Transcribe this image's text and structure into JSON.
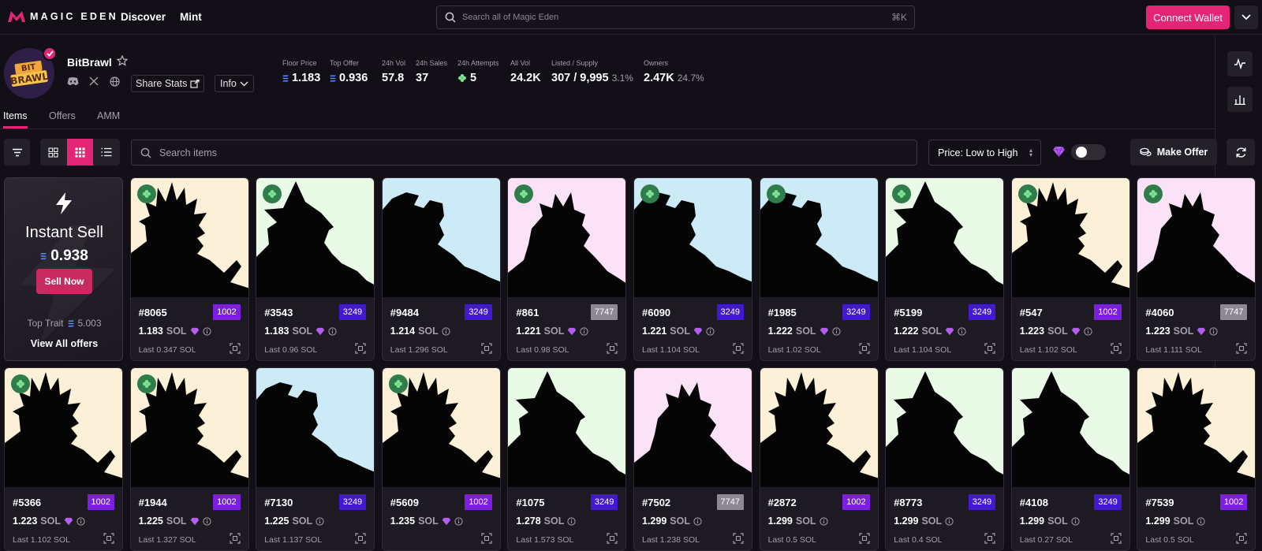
{
  "topbar": {
    "logo_text": "MAGIC EDEN",
    "nav": [
      "Discover",
      "Mint"
    ],
    "search_placeholder": "Search all of Magic Eden",
    "search_shortcut": "⌘K",
    "connect_label": "Connect Wallet"
  },
  "collection": {
    "name": "BitBrawl",
    "avatar_text": "BIT BRAWL",
    "share_label": "Share Stats",
    "info_label": "Info",
    "stats": [
      {
        "label": "Floor Price",
        "value": "1.183",
        "sol": true,
        "sub": ""
      },
      {
        "label": "Top Offer",
        "value": "0.936",
        "sol": true,
        "sub": ""
      },
      {
        "label": "24h Vol",
        "value": "57.8",
        "sol": false,
        "sub": ""
      },
      {
        "label": "24h Sales",
        "value": "37",
        "sol": false,
        "sub": ""
      },
      {
        "label": "24h Attempts",
        "value": "5",
        "sol": false,
        "clover": true,
        "sub": ""
      },
      {
        "label": "All Vol",
        "value": "24.2K",
        "sol": false,
        "sub": ""
      },
      {
        "label": "Listed / Supply",
        "value": "307 / 9,995",
        "sol": false,
        "sub": "3.1%"
      },
      {
        "label": "Owners",
        "value": "2.47K",
        "sol": false,
        "sub": "24.7%"
      }
    ]
  },
  "tabs": [
    "Items",
    "Offers",
    "AMM"
  ],
  "toolbar": {
    "search_placeholder": "Search items",
    "sort_label": "Price: Low to High",
    "make_offer_label": "Make Offer"
  },
  "instant_sell": {
    "title": "Instant Sell",
    "price": "0.938",
    "sell_label": "Sell Now",
    "trait_label": "Top Trait",
    "trait_value": "5.003",
    "view_all_label": "View All offers"
  },
  "colors": {
    "accent": "#e42575",
    "rank_purple": "#7c1fe0",
    "rank_blue": "#4318d1",
    "rank_gray": "#8e8794",
    "clover": "#2e7d4a"
  },
  "items": [
    {
      "id": "#8065",
      "rank": "1002",
      "tier": "purple",
      "price": "1.183",
      "unit": "SOL",
      "gem": true,
      "last": "Last 0.347 SOL",
      "bg": "#fdf0d8",
      "clover": true,
      "shape": 0
    },
    {
      "id": "#3543",
      "rank": "3249",
      "tier": "blue",
      "price": "1.183",
      "unit": "SOL",
      "gem": true,
      "last": "Last 0.96 SOL",
      "bg": "#e9fbe6",
      "clover": true,
      "shape": 1
    },
    {
      "id": "#9484",
      "rank": "3249",
      "tier": "blue",
      "price": "1.214",
      "unit": "SOL",
      "gem": false,
      "last": "Last 1.296 SOL",
      "bg": "#cdeaf7",
      "clover": false,
      "shape": 2
    },
    {
      "id": "#861",
      "rank": "7747",
      "tier": "gray",
      "price": "1.221",
      "unit": "SOL",
      "gem": true,
      "last": "Last 0.98 SOL",
      "bg": "#fbe2f6",
      "clover": true,
      "shape": 3
    },
    {
      "id": "#6090",
      "rank": "3249",
      "tier": "blue",
      "price": "1.221",
      "unit": "SOL",
      "gem": true,
      "last": "Last 1.104 SOL",
      "bg": "#cdeaf7",
      "clover": true,
      "shape": 2
    },
    {
      "id": "#1985",
      "rank": "3249",
      "tier": "blue",
      "price": "1.222",
      "unit": "SOL",
      "gem": true,
      "last": "Last 1.02 SOL",
      "bg": "#cdeaf7",
      "clover": true,
      "shape": 2
    },
    {
      "id": "#5199",
      "rank": "3249",
      "tier": "blue",
      "price": "1.222",
      "unit": "SOL",
      "gem": true,
      "last": "Last 1.104 SOL",
      "bg": "#e9fbe6",
      "clover": true,
      "shape": 1
    },
    {
      "id": "#547",
      "rank": "1002",
      "tier": "purple",
      "price": "1.223",
      "unit": "SOL",
      "gem": true,
      "last": "Last 1.102 SOL",
      "bg": "#fdf0d8",
      "clover": true,
      "shape": 0
    },
    {
      "id": "#4060",
      "rank": "7747",
      "tier": "gray",
      "price": "1.223",
      "unit": "SOL",
      "gem": true,
      "last": "Last 1.111 SOL",
      "bg": "#fbe2f6",
      "clover": true,
      "shape": 3
    },
    {
      "id": "#5366",
      "rank": "1002",
      "tier": "purple",
      "price": "1.223",
      "unit": "SOL",
      "gem": true,
      "last": "Last 1.102 SOL",
      "bg": "#fdf0d8",
      "clover": true,
      "shape": 0
    },
    {
      "id": "#1944",
      "rank": "1002",
      "tier": "purple",
      "price": "1.225",
      "unit": "SOL",
      "gem": true,
      "last": "Last 1.327 SOL",
      "bg": "#fdf0d8",
      "clover": true,
      "shape": 0
    },
    {
      "id": "#7130",
      "rank": "3249",
      "tier": "blue",
      "price": "1.225",
      "unit": "SOL",
      "gem": false,
      "last": "Last 1.137 SOL",
      "bg": "#cdeaf7",
      "clover": false,
      "shape": 2
    },
    {
      "id": "#5609",
      "rank": "1002",
      "tier": "purple",
      "price": "1.235",
      "unit": "SOL",
      "gem": true,
      "last": "",
      "bg": "#fdf0d8",
      "clover": true,
      "shape": 0
    },
    {
      "id": "#1075",
      "rank": "3249",
      "tier": "blue",
      "price": "1.278",
      "unit": "SOL",
      "gem": false,
      "last": "Last 1.573 SOL",
      "bg": "#e9fbe6",
      "clover": false,
      "shape": 1
    },
    {
      "id": "#7502",
      "rank": "7747",
      "tier": "gray",
      "price": "1.299",
      "unit": "SOL",
      "gem": false,
      "last": "Last 1.238 SOL",
      "bg": "#fbe2f6",
      "clover": false,
      "shape": 3
    },
    {
      "id": "#2872",
      "rank": "1002",
      "tier": "purple",
      "price": "1.299",
      "unit": "SOL",
      "gem": false,
      "last": "Last 0.5 SOL",
      "bg": "#fdf0d8",
      "clover": false,
      "shape": 0
    },
    {
      "id": "#8773",
      "rank": "3249",
      "tier": "blue",
      "price": "1.299",
      "unit": "SOL",
      "gem": false,
      "last": "Last 0.4 SOL",
      "bg": "#e9fbe6",
      "clover": false,
      "shape": 1
    },
    {
      "id": "#4108",
      "rank": "3249",
      "tier": "blue",
      "price": "1.299",
      "unit": "SOL",
      "gem": false,
      "last": "Last 0.27 SOL",
      "bg": "#e9fbe6",
      "clover": false,
      "shape": 1
    },
    {
      "id": "#7539",
      "rank": "1002",
      "tier": "purple",
      "price": "1.299",
      "unit": "SOL",
      "gem": false,
      "last": "Last 0.5 SOL",
      "bg": "#fdf0d8",
      "clover": false,
      "shape": 0
    }
  ]
}
